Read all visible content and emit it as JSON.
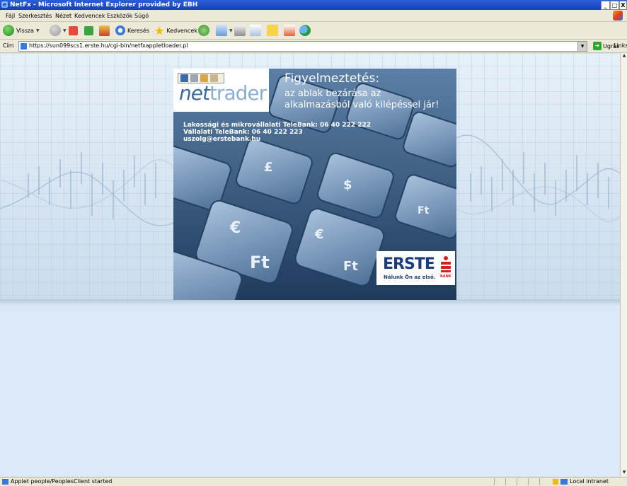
{
  "window": {
    "title": "NetFx - Microsoft Internet Explorer provided by EBH",
    "controls": [
      "_",
      "□",
      "X"
    ]
  },
  "menu": [
    "Fájl",
    "Szerkesztés",
    "Nézet",
    "Kedvencek",
    "Eszközök",
    "Súgó"
  ],
  "toolbar": {
    "back_label": "Vissza",
    "search_label": "Keresés",
    "favorites_label": "Kedvencek"
  },
  "address": {
    "label": "Cím",
    "url": "https://sun099scs1.erste.hu/cgi-bin/netfxappletloader.pl",
    "go_label": "Ugrás",
    "links_label": "Links"
  },
  "banner": {
    "logo_prefix": "net",
    "logo_suffix": "trader",
    "warning_title": "Figyelmeztetés:",
    "warning_line1": "az ablak bezárása az",
    "warning_line2": "alkalmazásból való kilépéssel jár!",
    "contact_line1": "Lakossági és mikrovállalati TeleBank: 06 40 222 222",
    "contact_line2": "Vállalati TeleBank: 06 40 222 223",
    "contact_line3": "uszolg@erstebank.hu",
    "brand_name": "ERSTE",
    "brand_bank": "BANK",
    "brand_slogan": "Nálunk Ön az első."
  },
  "status": {
    "text": "Applet people/PeoplesClient started",
    "zone": "Local intranet"
  },
  "colors": {
    "titlebar": "#1f4fc8",
    "content_bg": "#dbe9f6",
    "erste_blue": "#1b3e7a",
    "erste_red": "#d32027"
  }
}
